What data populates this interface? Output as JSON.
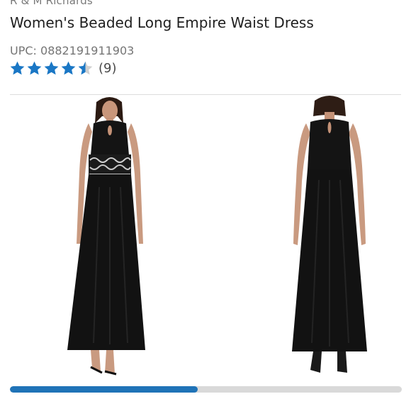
{
  "product": {
    "brand": "R & M Richards",
    "title": "Women's Beaded Long Empire Waist Dress",
    "upc": "UPC: 0882191911903",
    "rating": {
      "stars": 4.5,
      "max_stars": 5,
      "count_label": "(9)",
      "star_color": "#1a77c5",
      "empty_star_color": "#d0d0d0"
    }
  },
  "gallery": {
    "images": [
      {
        "name": "dress-front-view",
        "kind": "photo"
      },
      {
        "name": "dress-back-view",
        "kind": "photo"
      }
    ],
    "progress": 0.48,
    "progress_color": "#1f73b7",
    "track_color": "#d9d9d9"
  }
}
